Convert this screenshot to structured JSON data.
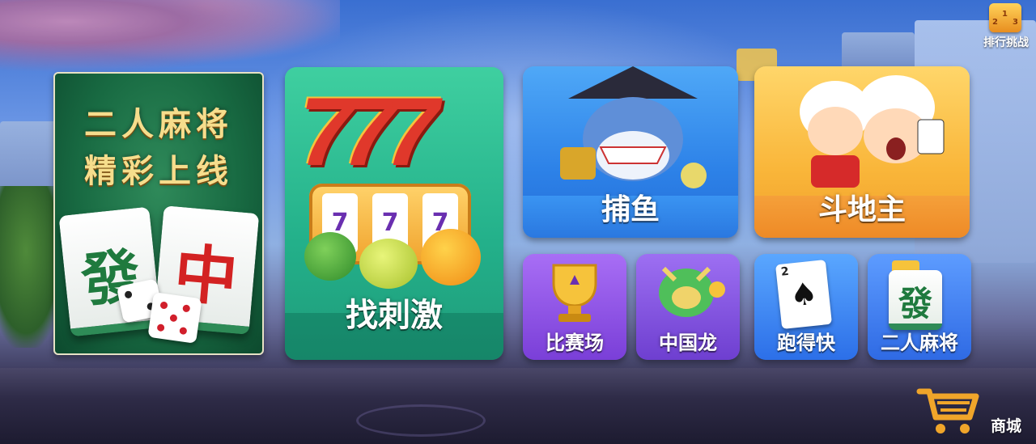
{
  "ranking": {
    "label": "排行挑战",
    "podium": [
      "2",
      "1",
      "3"
    ]
  },
  "promo": {
    "title_line1": "二人麻将",
    "title_line2": "精彩上线",
    "tile_left": "發",
    "tile_right": "中"
  },
  "games": {
    "slots": {
      "label": "找刺激",
      "seven": "777",
      "reel": [
        "7",
        "7",
        "7"
      ]
    },
    "fishing": {
      "label": "捕鱼"
    },
    "landlord": {
      "label": "斗地主"
    },
    "arena": {
      "label": "比赛场"
    },
    "dragon": {
      "label": "中国龙"
    },
    "run_fast": {
      "label": "跑得快",
      "card_rank": "2"
    },
    "mahjong2": {
      "label": "二人麻将",
      "tile": "發"
    }
  },
  "shop": {
    "label": "商城"
  },
  "colors": {
    "sky": "#3a6fd1",
    "promo_green": "#186a42",
    "slots_green": "#23b08a",
    "fishing_blue": "#2d82e8",
    "landlord_orange": "#f9b63a",
    "purple": "#7a3fd8",
    "blue": "#2c6fe8"
  }
}
